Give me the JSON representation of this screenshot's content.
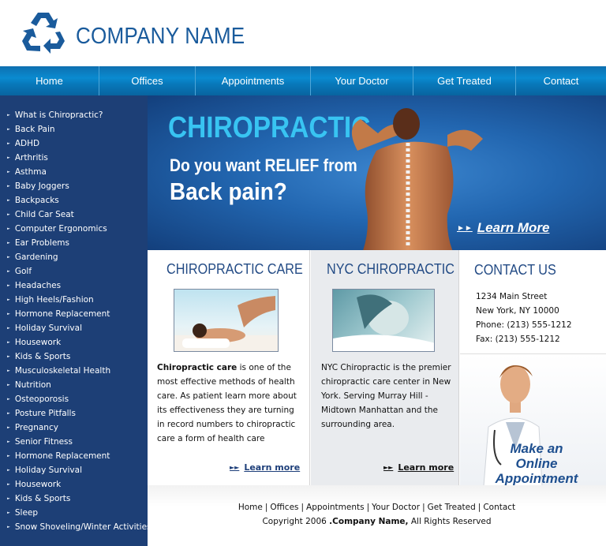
{
  "header": {
    "company_name": "COMPANY NAME",
    "logo_icon": "recycle-icon"
  },
  "nav": {
    "items": [
      {
        "label": "Home"
      },
      {
        "label": "Offices"
      },
      {
        "label": "Appointments"
      },
      {
        "label": "Your Doctor"
      },
      {
        "label": "Get Treated"
      },
      {
        "label": "Contact"
      }
    ]
  },
  "sidebar": {
    "items": [
      {
        "label": "What is Chiropractic?"
      },
      {
        "label": "Back Pain"
      },
      {
        "label": "ADHD"
      },
      {
        "label": "Arthritis"
      },
      {
        "label": "Asthma"
      },
      {
        "label": "Baby Joggers"
      },
      {
        "label": "Backpacks"
      },
      {
        "label": "Child Car Seat"
      },
      {
        "label": "Computer Ergonomics"
      },
      {
        "label": "Ear Problems"
      },
      {
        "label": "Gardening"
      },
      {
        "label": "Golf"
      },
      {
        "label": "Headaches"
      },
      {
        "label": "High Heels/Fashion"
      },
      {
        "label": "Hormone Replacement"
      },
      {
        "label": "Holiday Survival"
      },
      {
        "label": "Housework"
      },
      {
        "label": "Kids & Sports"
      },
      {
        "label": "Musculoskeletal Health"
      },
      {
        "label": "Nutrition"
      },
      {
        "label": "Osteoporosis"
      },
      {
        "label": "Posture Pitfalls"
      },
      {
        "label": "Pregnancy"
      },
      {
        "label": "Senior Fitness"
      },
      {
        "label": "Hormone Replacement"
      },
      {
        "label": "Holiday Survival"
      },
      {
        "label": "Housework"
      },
      {
        "label": "Kids & Sports"
      },
      {
        "label": "Sleep"
      },
      {
        "label": "Snow Shoveling/Winter Activities"
      }
    ]
  },
  "hero": {
    "title": "CHIROPRACTIC",
    "line1": "Do you want RELIEF from",
    "line2": "Back pain?",
    "learn_more": "Learn More"
  },
  "chiro_care": {
    "title": "CHIROPRACTIC CARE",
    "text_bold": "Chiropractic care",
    "text_rest": " is one of the most effective methods of health care. As patient learn more about its effectiveness they are turning in record numbers to chiropractic care a form of health care",
    "learn_more": "Learn more"
  },
  "nyc": {
    "title": "NYC CHIROPRACTIC",
    "text": "NYC Chiropractic is the premier chiropractic care center in New York. Serving Murray Hill - Midtown Manhattan and the surrounding area.",
    "learn_more": "Learn more"
  },
  "contact": {
    "title": "CONTACT US",
    "address1": "1234 Main Street",
    "address2": "New York, NY 10000",
    "phone": "Phone: (213) 555-1212",
    "fax": "Fax:  (213) 555-1212",
    "appointment": "Make an Online Appointment"
  },
  "footer": {
    "links": [
      "Home",
      "Offices",
      "Appointments",
      "Your Doctor",
      "Get Treated",
      "Contact"
    ],
    "separator": "|",
    "copyright_prefix": "Copyright 2006 ",
    "copyright_company": ".Company Name,",
    "copyright_suffix": " All Rights Reserved"
  },
  "colors": {
    "brand_blue": "#1a5b9c",
    "sidebar_bg": "#1d3f76",
    "hero_title": "#38c4f2",
    "heading_blue": "#234b85"
  }
}
